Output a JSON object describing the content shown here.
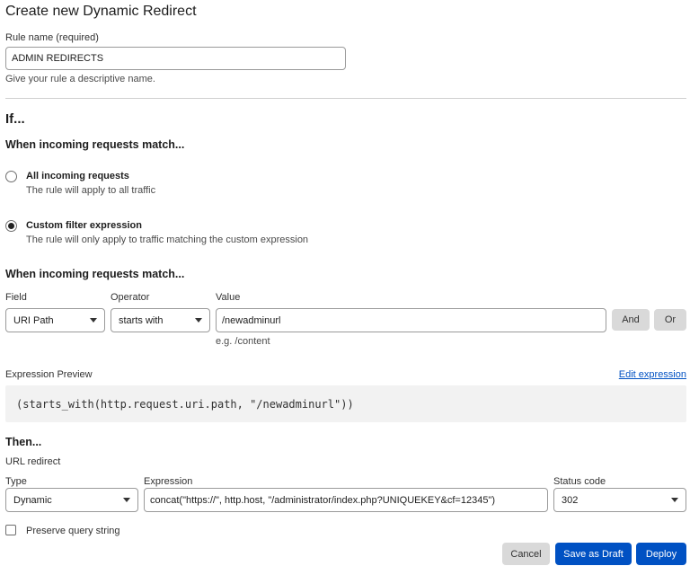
{
  "page": {
    "title": "Create new Dynamic Redirect"
  },
  "rule_name": {
    "label": "Rule name (required)",
    "value": "ADMIN REDIRECTS",
    "help": "Give your rule a descriptive name."
  },
  "if_section": {
    "heading": "If...",
    "match_heading": "When incoming requests match...",
    "options": [
      {
        "title": "All incoming requests",
        "description": "The rule will apply to all traffic",
        "selected": false
      },
      {
        "title": "Custom filter expression",
        "description": "The rule will only apply to traffic matching the custom expression",
        "selected": true
      }
    ],
    "match_heading_2": "When incoming requests match..."
  },
  "filter": {
    "field_label": "Field",
    "field_value": "URI Path",
    "operator_label": "Operator",
    "operator_value": "starts with",
    "value_label": "Value",
    "value_value": "/newadminurl",
    "value_hint": "e.g. /content",
    "and_label": "And",
    "or_label": "Or"
  },
  "expression_preview": {
    "label": "Expression Preview",
    "edit_link": "Edit expression",
    "code": "(starts_with(http.request.uri.path, \"/newadminurl\"))"
  },
  "then_section": {
    "heading": "Then...",
    "action": "URL redirect",
    "type_label": "Type",
    "type_value": "Dynamic",
    "expression_label": "Expression",
    "expression_value": "concat(\"https://\", http.host, \"/administrator/index.php?UNIQUEKEY&cf=12345\")",
    "status_label": "Status code",
    "status_value": "302",
    "preserve_label": "Preserve query string",
    "preserve_checked": false
  },
  "footer": {
    "cancel_label": "Cancel",
    "draft_label": "Save as Draft",
    "deploy_label": "Deploy"
  },
  "colors": {
    "accent": "#0051c3",
    "grey_button": "#d9d9d9",
    "preview_bg": "#f2f2f2"
  }
}
